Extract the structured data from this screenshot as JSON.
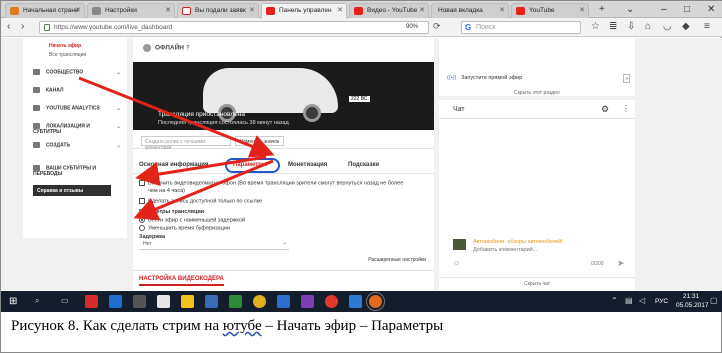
{
  "browser": {
    "tabs": [
      {
        "label": "Начальная страни",
        "color": "#e07a1e"
      },
      {
        "label": "Настройки",
        "color": "#888888"
      },
      {
        "label": "Вы подали заявк",
        "color": "#d32222"
      },
      {
        "label": "Панель управлен",
        "color": "#e62117"
      },
      {
        "label": "Видео - YouTube",
        "color": "#e62117"
      },
      {
        "label": "Новая вкладка",
        "color": "#cccccc"
      },
      {
        "label": "YouTube",
        "color": "#e62117"
      }
    ],
    "url": "https://www.youtube.com/live_dashboard",
    "zoom": "90%",
    "search_placeholder": "Поиск",
    "search_engine_mark": "G"
  },
  "sidebar": {
    "start_stream": "Начать эфир",
    "broadcasts": "Все трансляции",
    "items": [
      "Сообщество",
      "Канал",
      "YouTube Analytics",
      "Локализация и субтитры",
      "Создать",
      "Ваши субтитры и переводы"
    ],
    "help_button": "Справка и отзывы"
  },
  "main": {
    "status": "ОФЛАЙН",
    "video_title": "Трансляция приостановлена",
    "video_subtitle": "Последняя трансляция состоялась 38 минут назад",
    "plate": "222 ВС",
    "share_placeholder": "Создать ролик с лучшими моментами",
    "change_button": "Изменить значок",
    "tabs": [
      "Основная информация",
      "Параметры",
      "Монетизация",
      "Подсказки"
    ],
    "dvr_label": "Включить видеовидеомагнитофон (Во время трансляции зрители смогут вернуться назад не более",
    "dvr_label2": "чем на 4 часа)",
    "unlisted_label": "Сделать запись доступной только по ссылке",
    "latency_heading": "Параметры трансляции",
    "latency_low": "Вести эфир с наименьшей задержкой",
    "latency_buffer": "Уменьшить время буферизации",
    "delay_heading": "Задержка",
    "delay_value": "Нет",
    "advanced": "Расширенные настройки",
    "encoder": "НАСТРОЙКА ВИДЕОКОДЕРА"
  },
  "right_panel": {
    "start_live": "Запустите прямой эфир",
    "hide_section": "Скрыть этот раздел",
    "chat_title": "Чат",
    "chat_author": "Автомобили, обзоры автомобилей!",
    "chat_placeholder": "Добавить комментарий...",
    "char_count": "0/200",
    "hide_chat": "Скрыть чат"
  },
  "taskbar": {
    "language": "РУС",
    "time": "21:31",
    "date": "05.05.2017"
  },
  "caption": {
    "prefix": "Рисунок 8. Как сделать стрим на ",
    "underlined": "ютубе",
    "suffix": " – Начать эфир – Параметры"
  },
  "colors": {
    "youtube_red": "#d32222",
    "arrow": "#e2231a",
    "highlight_ring": "#2356c8",
    "taskbar": "#141d2b"
  }
}
